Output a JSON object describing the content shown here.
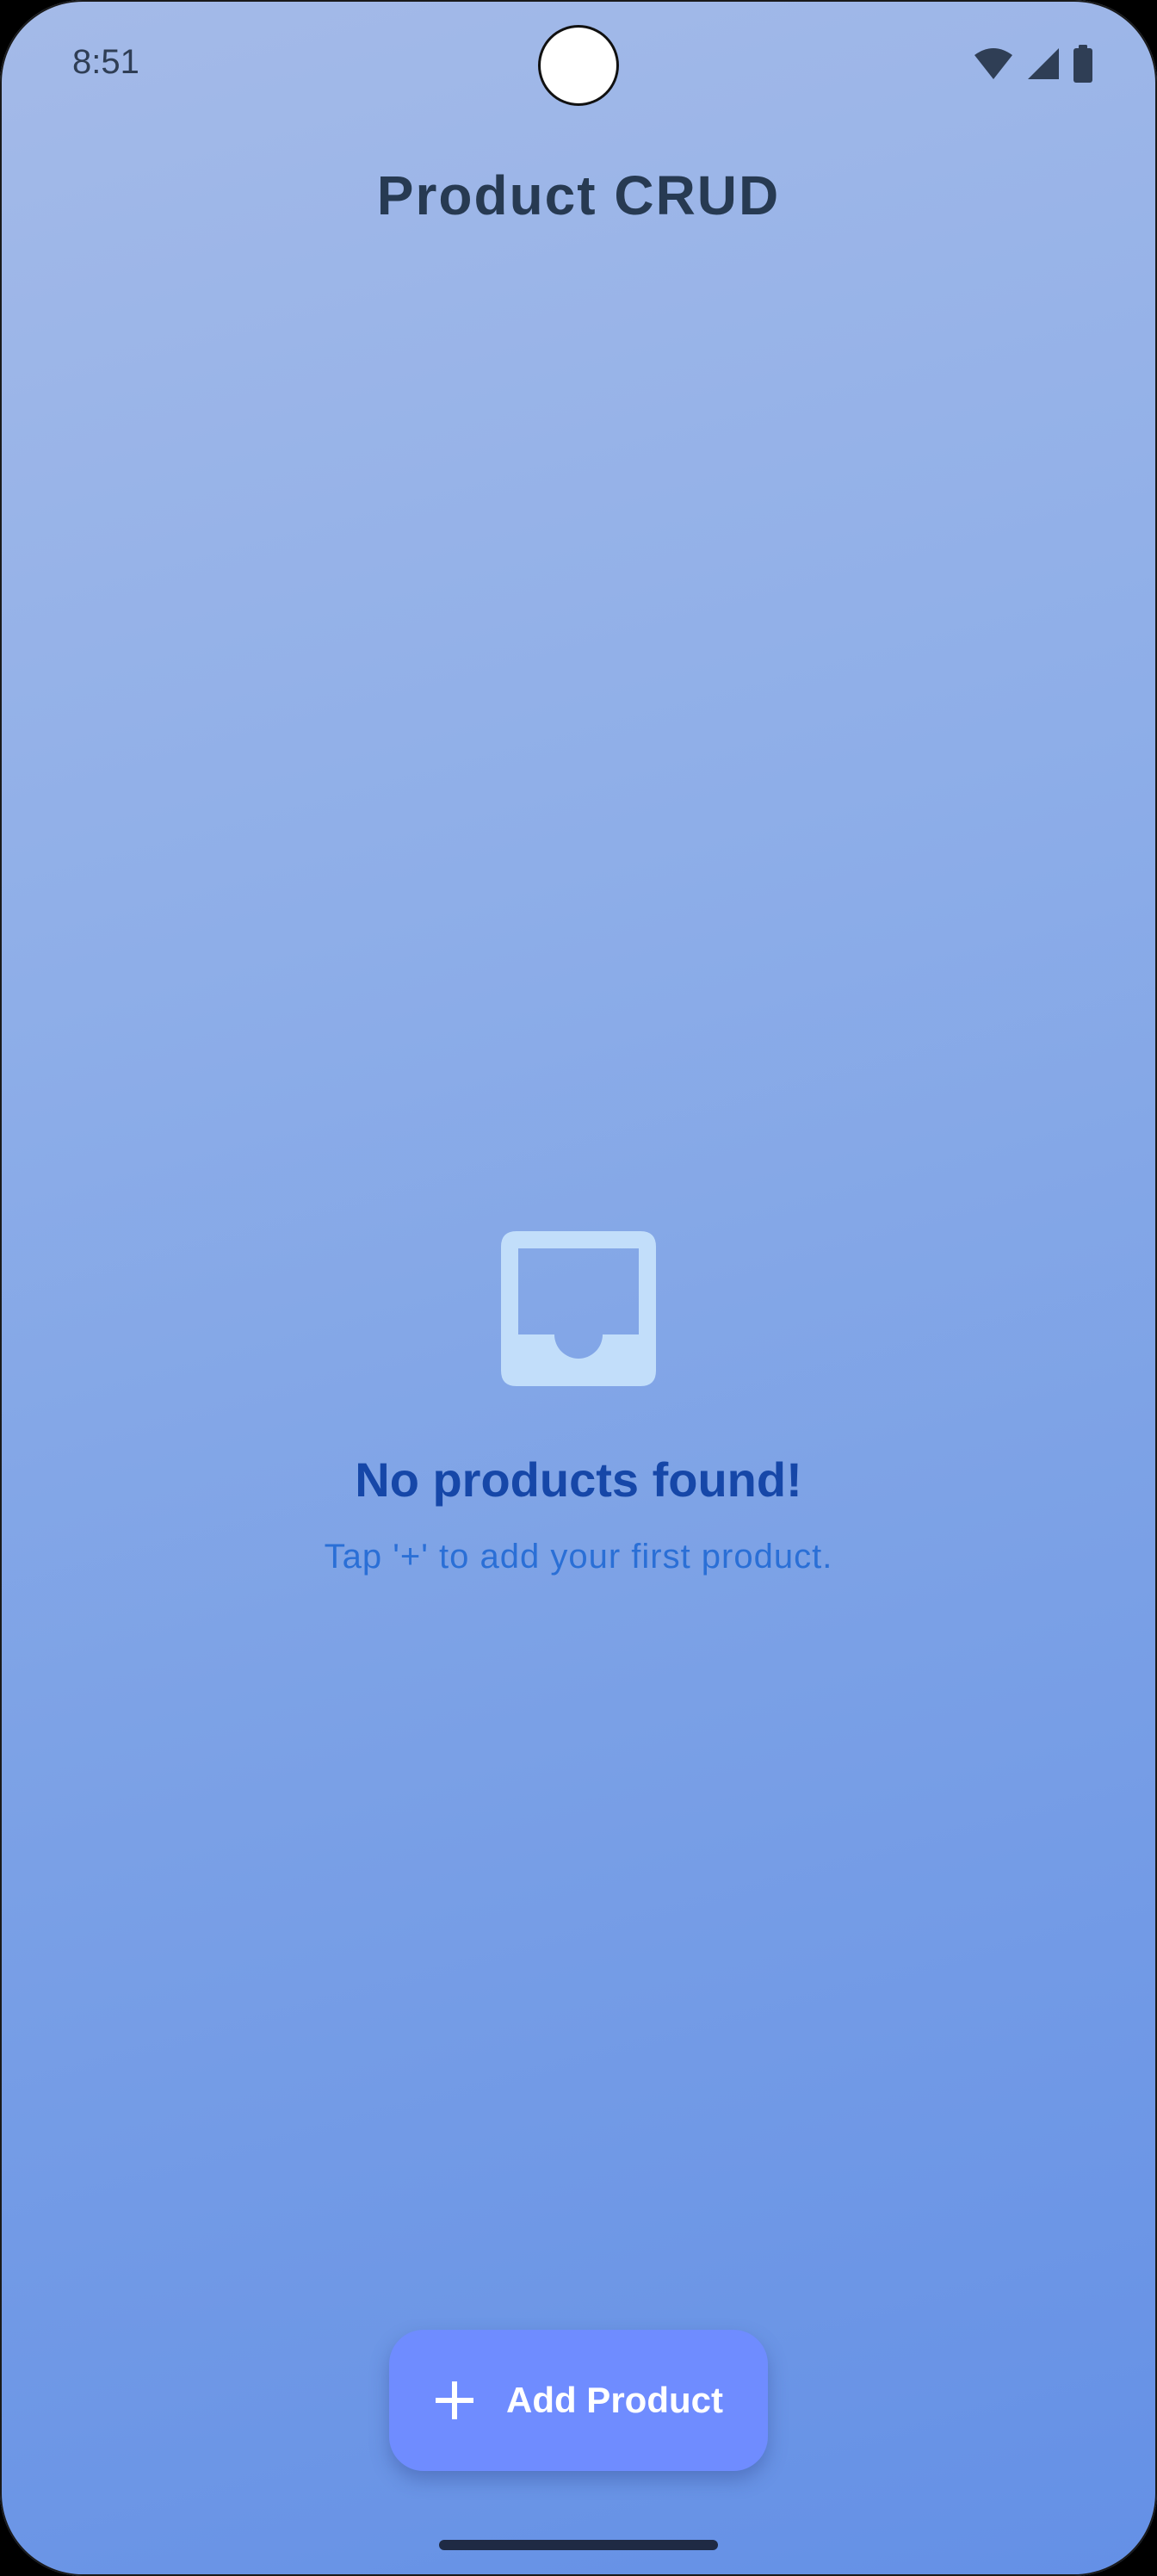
{
  "status_bar": {
    "time": "8:51",
    "icons": [
      "wifi-icon",
      "cellular-signal-icon",
      "battery-icon"
    ]
  },
  "app": {
    "title": "Product CRUD"
  },
  "empty_state": {
    "icon": "inbox-tray-icon",
    "title": "No products found!",
    "subtitle": "Tap '+' to add your first product."
  },
  "fab": {
    "icon": "plus-icon",
    "label": "Add Product"
  },
  "colors": {
    "background_top": "#a4bae8",
    "background_bottom": "#6490e6",
    "title_text": "#273a52",
    "empty_title": "#1647a8",
    "empty_subtitle": "#2a6fd6",
    "empty_icon": "#c2defa",
    "fab_background": "#6f8cff",
    "fab_text": "#ffffff"
  }
}
